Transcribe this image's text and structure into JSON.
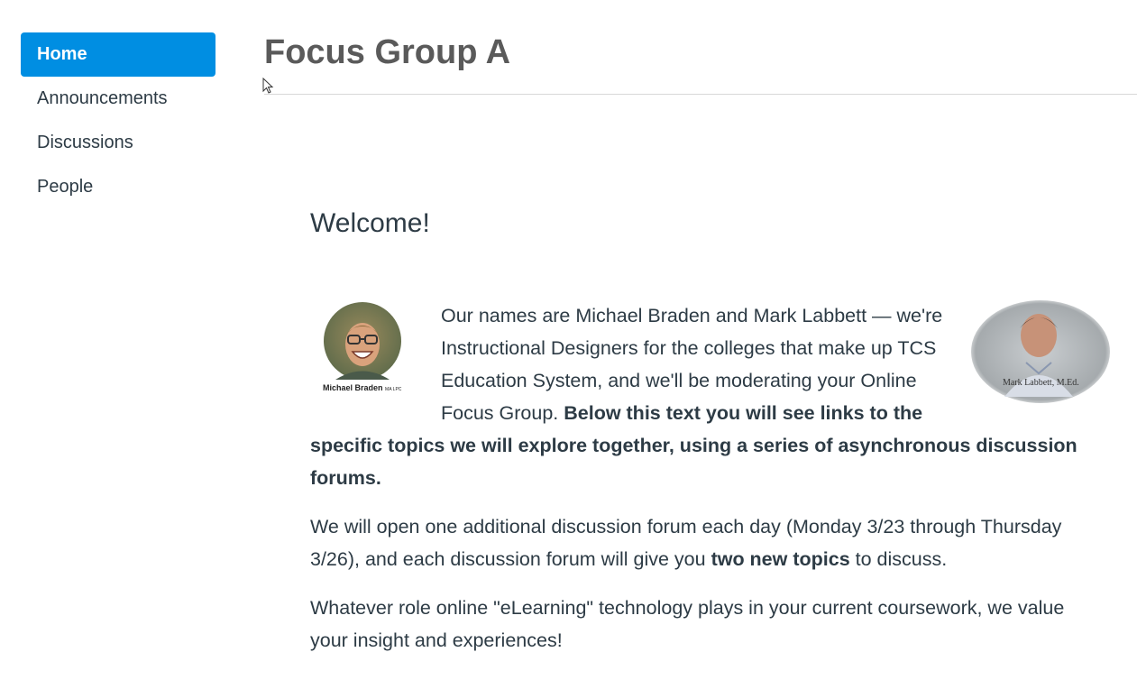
{
  "nav": {
    "items": [
      {
        "label": "Home",
        "active": true
      },
      {
        "label": "Announcements",
        "active": false
      },
      {
        "label": "Discussions",
        "active": false
      },
      {
        "label": "People",
        "active": false
      }
    ]
  },
  "page": {
    "title": "Focus Group A"
  },
  "content": {
    "welcome": "Welcome!",
    "intro_text": "Our names are Michael Braden and Mark Labbett — we're Instructional Designers for the colleges that make up TCS Education System, and we'll be moderating your Online Focus Group. ",
    "intro_bold": "Below this text you will see links to the specific topics we will explore together, using a series of asynchronous discussion forums.",
    "p2_start": "We will open one additional discussion forum each day (Monday 3/23 through Thursday 3/26), and each discussion forum will give you ",
    "p2_bold": "two new topics",
    "p2_end": " to discuss.",
    "p3": "Whatever role online \"eLearning\" technology plays in your current coursework, we value your insight and experiences!",
    "left_photo_caption": "Michael Braden",
    "left_photo_caption_suffix": "MA LPC",
    "right_photo_caption": "Mark Labbett, M.Ed."
  },
  "colors": {
    "accent": "#008ee2",
    "text": "#2d3b45",
    "title": "#5a5a5a"
  }
}
